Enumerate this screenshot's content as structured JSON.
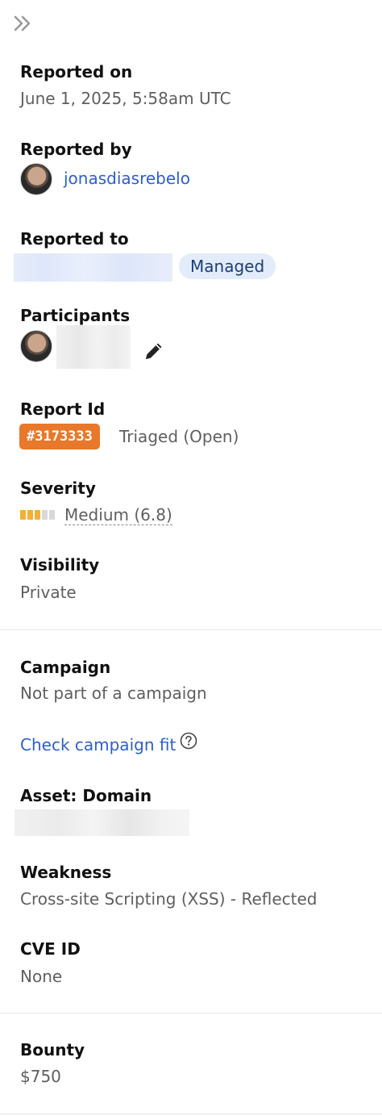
{
  "colors": {
    "link": "#2d5fcb",
    "badge_bg": "#e8782a",
    "managed_bg": "#e3ecfb",
    "severity_filled": "#f2b134",
    "severity_empty": "#d9d9d9"
  },
  "toolbar": {
    "collapse_icon": "double-chevron-right-icon"
  },
  "reported_on": {
    "label": "Reported on",
    "value": "June 1, 2025, 5:58am UTC"
  },
  "reported_by": {
    "label": "Reported by",
    "username": "jonasdiasrebelo",
    "avatar_icon": "user-avatar"
  },
  "reported_to": {
    "label": "Reported to",
    "badge": "Managed"
  },
  "participants": {
    "label": "Participants",
    "edit_icon": "pencil-icon"
  },
  "report_id": {
    "label": "Report Id",
    "id": "#3173333",
    "status": "Triaged (Open)"
  },
  "severity": {
    "label": "Severity",
    "value": "Medium (6.8)",
    "level_filled": 3,
    "level_total": 5
  },
  "visibility": {
    "label": "Visibility",
    "value": "Private"
  },
  "campaign": {
    "label": "Campaign",
    "value": "Not part of a campaign",
    "link": "Check campaign fit",
    "help_icon": "question-circle-icon"
  },
  "asset": {
    "label": "Asset: Domain"
  },
  "weakness": {
    "label": "Weakness",
    "value": "Cross-site Scripting (XSS) - Reflected"
  },
  "cve": {
    "label": "CVE ID",
    "value": "None"
  },
  "bounty": {
    "label": "Bounty",
    "value": "$750"
  }
}
